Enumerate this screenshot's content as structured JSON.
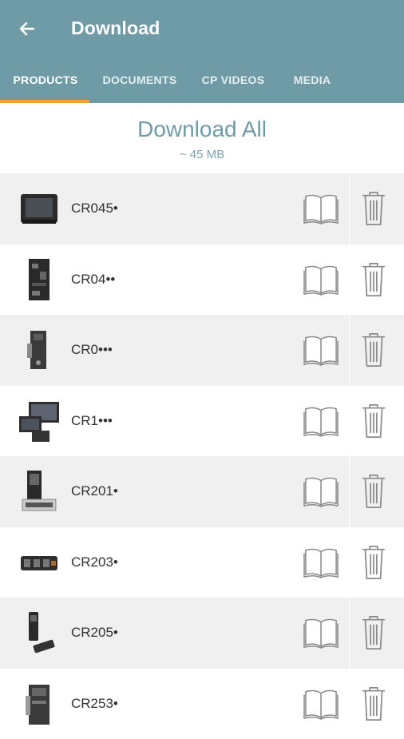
{
  "header": {
    "title": "Download",
    "back_icon": "arrow-left-icon",
    "background_color": "#6f9ba6",
    "accent_color": "#f0a232"
  },
  "tabs": [
    {
      "label": "PRODUCTS",
      "active": true
    },
    {
      "label": "DOCUMENTS",
      "active": false
    },
    {
      "label": "CP VIDEOS",
      "active": false
    },
    {
      "label": "MEDIA",
      "active": false
    }
  ],
  "download_all": {
    "label": "Download All",
    "size": "~ 45 MB"
  },
  "products": [
    {
      "name": "CR045•",
      "thumb": "display-panel"
    },
    {
      "name": "CR04••",
      "thumb": "circuit-board"
    },
    {
      "name": "CR0•••",
      "thumb": "controller-module"
    },
    {
      "name": "CR1•••",
      "thumb": "dual-displays"
    },
    {
      "name": "CR201•",
      "thumb": "panel-module"
    },
    {
      "name": "CR203•",
      "thumb": "io-module"
    },
    {
      "name": "CR205•",
      "thumb": "sensor-pair"
    },
    {
      "name": "CR253•",
      "thumb": "din-rail-module"
    }
  ],
  "icons": {
    "manual": "book-icon",
    "delete": "trash-icon"
  }
}
